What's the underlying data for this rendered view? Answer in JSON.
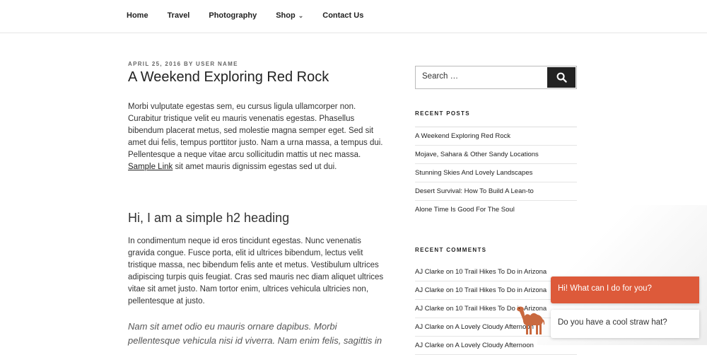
{
  "nav": {
    "items": [
      {
        "label": "Home"
      },
      {
        "label": "Travel"
      },
      {
        "label": "Photography"
      },
      {
        "label": "Shop"
      },
      {
        "label": "Contact Us"
      }
    ]
  },
  "post": {
    "meta": "April 25, 2016 by User Name",
    "title": "A Weekend Exploring Red Rock",
    "para1_text": "Morbi vulputate egestas sem, eu cursus ligula ullamcorper non. Curabitur tristique velit eu mauris venenatis egestas. Phasellus bibendum placerat metus, sed molestie magna semper eget. Sed sit amet dui felis, tempus porttitor justo. Nam a urna massa, a tempus dui. Pellentesque a neque vitae arcu sollicitudin mattis ut nec massa.",
    "link_label": "Sample Link",
    "para1_tail": "sit amet mauris dignissim egestas sed ut dui.",
    "h2": "Hi, I am a simple h2 heading",
    "para2": "In condimentum neque id eros tincidunt egestas. Nunc venenatis gravida congue. Fusce porta, elit id ultrices bibendum, lectus velit tristique massa, nec bibendum felis ante et metus. Vestibulum ultrices adipiscing turpis quis feugiat. Cras sed mauris nec diam aliquet ultrices vitae sit amet justo. Nam tortor enim, ultrices vehicula ultricies non, pellentesque at justo.",
    "quote": "Nam sit amet odio eu mauris ornare dapibus. Morbi pellentesque vehicula nisi id viverra. Nam enim felis, sagittis in"
  },
  "sidebar": {
    "search_placeholder": "Search …",
    "recent_posts_title": "Recent Posts",
    "recent_posts": [
      {
        "label": "A Weekend Exploring Red Rock"
      },
      {
        "label": "Mojave, Sahara & Other Sandy Locations"
      },
      {
        "label": "Stunning Skies And Lovely Landscapes"
      },
      {
        "label": "Desert Survival: How To Build A Lean-to"
      },
      {
        "label": "Alone Time Is Good For The Soul"
      }
    ],
    "recent_comments_title": "Recent Comments",
    "recent_comments": [
      {
        "label": "AJ Clarke on 10 Trail Hikes To Do in Arizona"
      },
      {
        "label": "AJ Clarke on 10 Trail Hikes To Do in Arizona"
      },
      {
        "label": "AJ Clarke on 10 Trail Hikes To Do in Arizona"
      },
      {
        "label": "AJ Clarke on A Lovely Cloudy Afternoon"
      },
      {
        "label": "AJ Clarke on A Lovely Cloudy Afternoon"
      }
    ]
  },
  "chat": {
    "greeting": "Hi! What can I do for you?",
    "question": "Do you have a cool straw hat?",
    "accent_color": "#dd5a3a",
    "mascot_icon": "camel-icon"
  }
}
